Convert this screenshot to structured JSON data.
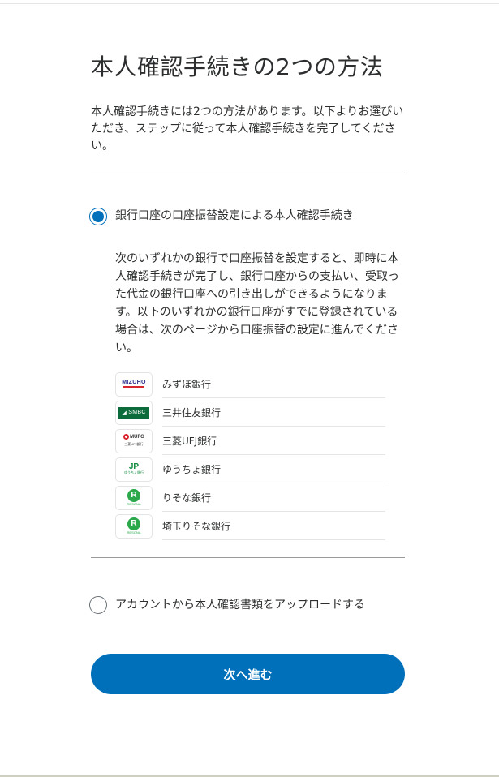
{
  "page": {
    "title": "本人確認手続きの2つの方法",
    "intro": "本人確認手続きには2つの方法があります。以下よりお選びいただき、ステップに従って本人確認手続きを完了してください。"
  },
  "option_bank": {
    "label": "銀行口座の口座振替設定による本人確認手続き",
    "selected": true,
    "description": "次のいずれかの銀行で口座振替を設定すると、即時に本人確認手続きが完了し、銀行口座からの支払い、受取った代金の銀行口座への引き出しができるようになります。以下のいずれかの銀行口座がすでに登録されている場合は、次のページから口座振替の設定に進んでください。",
    "banks": [
      {
        "name": "みずほ銀行",
        "logo_icon": "mizuho-logo",
        "logo_text": "MIZUHO"
      },
      {
        "name": "三井住友銀行",
        "logo_icon": "smbc-logo",
        "logo_text": "SMBC"
      },
      {
        "name": "三菱UFJ銀行",
        "logo_icon": "mufg-logo",
        "logo_text": "MUFG",
        "logo_sub": "三菱UFJ銀行"
      },
      {
        "name": "ゆうちょ銀行",
        "logo_icon": "japan-post-logo",
        "logo_text": "JP",
        "logo_sub": "ゆうちょ銀行"
      },
      {
        "name": "りそな銀行",
        "logo_icon": "resona-logo",
        "logo_text": "R",
        "logo_sub": "RESONA"
      },
      {
        "name": "埼玉りそな銀行",
        "logo_icon": "saitama-resona-logo",
        "logo_text": "R",
        "logo_sub": "RESONA"
      }
    ]
  },
  "option_upload": {
    "label": "アカウントから本人確認書類をアップロードする",
    "selected": false
  },
  "next_button": {
    "label": "次へ進む"
  },
  "colors": {
    "primary": "#0070ba",
    "text": "#2c2e2f",
    "divider": "#9a9a9a"
  }
}
